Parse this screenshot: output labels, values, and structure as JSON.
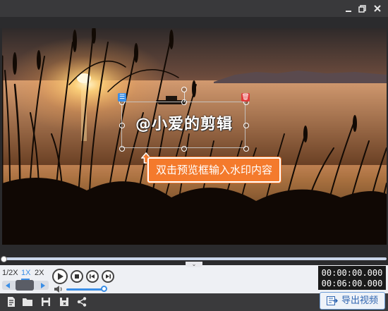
{
  "window": {
    "minimize_icon": "minimize-icon",
    "restore_icon": "restore-icon",
    "close_icon": "close-icon"
  },
  "watermark": {
    "text": "@小爱的剪辑",
    "list_icon": "list-icon",
    "delete_icon": "trash-icon"
  },
  "tip": {
    "text": "双击预览框输入水印内容",
    "color": "#f47a2c"
  },
  "playback": {
    "speeds": [
      "1/2X",
      "1X",
      "2X"
    ],
    "active_speed": "1X",
    "current_time": "00:00:00.000",
    "total_time": "00:06:00.000",
    "progress_fraction": 0.0,
    "volume_fraction": 1.0
  },
  "toolbar": {
    "icons": [
      "new-file-icon",
      "open-folder-icon",
      "save-icon",
      "save-as-icon",
      "share-icon"
    ]
  },
  "export": {
    "label": "导出视频",
    "icon": "export-icon"
  },
  "colors": {
    "accent": "#3a8ee6",
    "window_bg": "#2a2a2c",
    "control_bg": "#eef0f4"
  }
}
